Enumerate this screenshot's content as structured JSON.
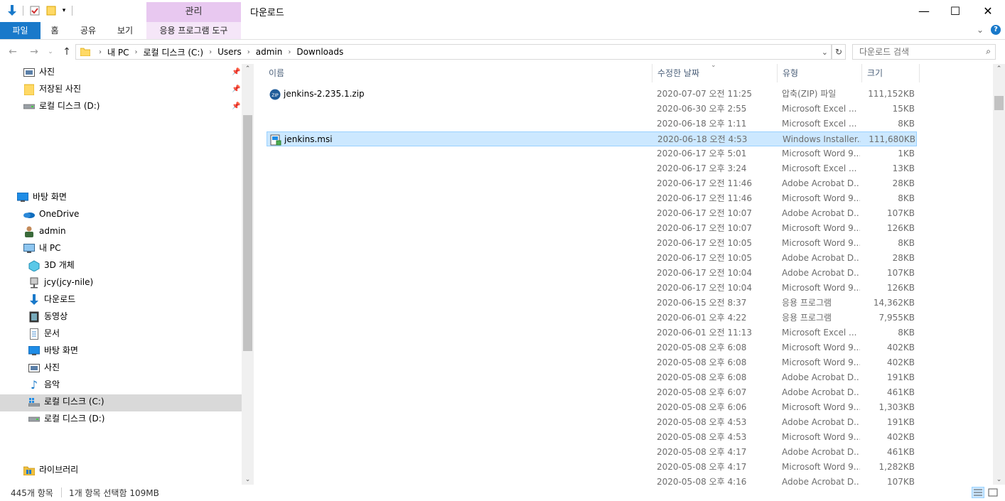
{
  "window": {
    "title": "다운로드",
    "context_tab": "관리",
    "controls": {
      "minimize": "—",
      "maximize": "☐",
      "close": "✕"
    }
  },
  "ribbon": {
    "tabs": [
      "파일",
      "홈",
      "공유",
      "보기",
      "응용 프로그램 도구"
    ]
  },
  "address": {
    "crumbs": [
      "내 PC",
      "로컬 디스크 (C:)",
      "Users",
      "admin",
      "Downloads"
    ],
    "search_placeholder": "다운로드 검색"
  },
  "nav": {
    "items": [
      {
        "label": "사진",
        "icon": "pictures-icon",
        "pinned": true
      },
      {
        "label": "저장된 사진",
        "icon": "folder-icon",
        "pinned": true
      },
      {
        "label": "로컬 디스크 (D:)",
        "icon": "drive-icon",
        "pinned": true
      },
      {
        "label": "바탕 화면",
        "icon": "desktop-icon"
      },
      {
        "label": "OneDrive",
        "icon": "onedrive-icon"
      },
      {
        "label": "admin",
        "icon": "user-icon"
      },
      {
        "label": "내 PC",
        "icon": "pc-icon"
      },
      {
        "label": "3D 개체",
        "icon": "3d-objects-icon"
      },
      {
        "label": "jcy(jcy-nile)",
        "icon": "network-drive-icon"
      },
      {
        "label": "다운로드",
        "icon": "downloads-icon"
      },
      {
        "label": "동영상",
        "icon": "videos-icon"
      },
      {
        "label": "문서",
        "icon": "documents-icon"
      },
      {
        "label": "바탕 화면",
        "icon": "desktop-icon"
      },
      {
        "label": "사진",
        "icon": "pictures-icon"
      },
      {
        "label": "음악",
        "icon": "music-icon"
      },
      {
        "label": "로컬 디스크 (C:)",
        "icon": "windows-drive-icon",
        "selected": true
      },
      {
        "label": "로컬 디스크 (D:)",
        "icon": "drive-icon"
      },
      {
        "label": "라이브러리",
        "icon": "library-icon"
      }
    ]
  },
  "columns": {
    "name": "이름",
    "date": "수정한 날짜",
    "type": "유형",
    "size": "크기"
  },
  "files": [
    {
      "name": "jenkins-2.235.1.zip",
      "date": "2020-07-07 오전 11:25",
      "type": "압축(ZIP) 파일",
      "size": "111,152KB",
      "icon": "zip-icon"
    },
    {
      "name": "",
      "date": "2020-06-30 오후 2:55",
      "type": "Microsoft Excel ...",
      "size": "15KB"
    },
    {
      "name": "",
      "date": "2020-06-18 오후 1:11",
      "type": "Microsoft Excel ...",
      "size": "8KB"
    },
    {
      "name": "jenkins.msi",
      "date": "2020-06-18 오전 4:53",
      "type": "Windows Installer...",
      "size": "111,680KB",
      "icon": "msi-icon",
      "selected": true
    },
    {
      "name": "",
      "date": "2020-06-17 오후 5:01",
      "type": "Microsoft Word 9...",
      "size": "1KB"
    },
    {
      "name": "",
      "date": "2020-06-17 오후 3:24",
      "type": "Microsoft Excel ...",
      "size": "13KB"
    },
    {
      "name": "",
      "date": "2020-06-17 오전 11:46",
      "type": "Adobe Acrobat D...",
      "size": "28KB"
    },
    {
      "name": "",
      "date": "2020-06-17 오전 11:46",
      "type": "Microsoft Word 9...",
      "size": "8KB"
    },
    {
      "name": "",
      "date": "2020-06-17 오전 10:07",
      "type": "Adobe Acrobat D...",
      "size": "107KB"
    },
    {
      "name": "",
      "date": "2020-06-17 오전 10:07",
      "type": "Microsoft Word 9...",
      "size": "126KB"
    },
    {
      "name": "",
      "date": "2020-06-17 오전 10:05",
      "type": "Microsoft Word 9...",
      "size": "8KB"
    },
    {
      "name": "",
      "date": "2020-06-17 오전 10:05",
      "type": "Adobe Acrobat D...",
      "size": "28KB"
    },
    {
      "name": "",
      "date": "2020-06-17 오전 10:04",
      "type": "Adobe Acrobat D...",
      "size": "107KB"
    },
    {
      "name": "",
      "date": "2020-06-17 오전 10:04",
      "type": "Microsoft Word 9...",
      "size": "126KB"
    },
    {
      "name": "",
      "date": "2020-06-15 오전 8:37",
      "type": "응용 프로그램",
      "size": "14,362KB"
    },
    {
      "name": "",
      "date": "2020-06-01 오후 4:22",
      "type": "응용 프로그램",
      "size": "7,955KB"
    },
    {
      "name": "",
      "date": "2020-06-01 오전 11:13",
      "type": "Microsoft Excel ...",
      "size": "8KB"
    },
    {
      "name": "",
      "date": "2020-05-08 오후 6:08",
      "type": "Microsoft Word 9...",
      "size": "402KB"
    },
    {
      "name": "",
      "date": "2020-05-08 오후 6:08",
      "type": "Microsoft Word 9...",
      "size": "402KB"
    },
    {
      "name": "",
      "date": "2020-05-08 오후 6:08",
      "type": "Adobe Acrobat D...",
      "size": "191KB"
    },
    {
      "name": "",
      "date": "2020-05-08 오후 6:07",
      "type": "Adobe Acrobat D...",
      "size": "461KB"
    },
    {
      "name": "",
      "date": "2020-05-08 오후 6:06",
      "type": "Microsoft Word 9...",
      "size": "1,303KB"
    },
    {
      "name": "",
      "date": "2020-05-08 오후 4:53",
      "type": "Adobe Acrobat D...",
      "size": "191KB"
    },
    {
      "name": "",
      "date": "2020-05-08 오후 4:53",
      "type": "Microsoft Word 9...",
      "size": "402KB"
    },
    {
      "name": "",
      "date": "2020-05-08 오후 4:17",
      "type": "Adobe Acrobat D...",
      "size": "461KB"
    },
    {
      "name": "",
      "date": "2020-05-08 오후 4:17",
      "type": "Microsoft Word 9...",
      "size": "1,282KB"
    },
    {
      "name": "",
      "date": "2020-05-08 오후 4:16",
      "type": "Adobe Acrobat D...",
      "size": "107KB"
    }
  ],
  "status": {
    "count": "445개 항목",
    "selection": "1개 항목 선택함 109MB"
  }
}
